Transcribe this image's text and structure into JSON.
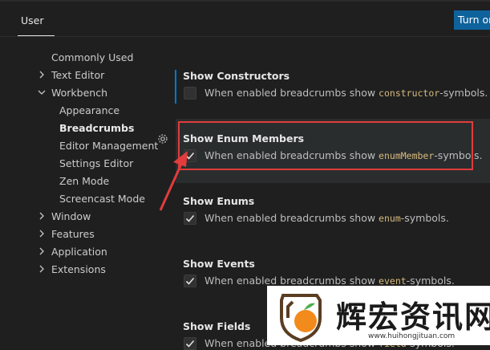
{
  "header": {
    "tab_user": "User",
    "turn_on_label": "Turn on"
  },
  "tree": {
    "commonly_used": "Commonly Used",
    "text_editor": "Text Editor",
    "workbench": "Workbench",
    "appearance": "Appearance",
    "breadcrumbs": "Breadcrumbs",
    "editor_management": "Editor Management",
    "settings_editor": "Settings Editor",
    "zen_mode": "Zen Mode",
    "screencast_mode": "Screencast Mode",
    "window": "Window",
    "features": "Features",
    "application": "Application",
    "extensions": "Extensions"
  },
  "settings": [
    {
      "title": "Show Constructors",
      "desc_pre": "When enabled breadcrumbs show ",
      "desc_code": "constructor",
      "desc_post": "-symbols.",
      "checked": false
    },
    {
      "title": "Show Enum Members",
      "desc_pre": "When enabled breadcrumbs show ",
      "desc_code": "enumMember",
      "desc_post": "-symbols.",
      "checked": true
    },
    {
      "title": "Show Enums",
      "desc_pre": "When enabled breadcrumbs show ",
      "desc_code": "enum",
      "desc_post": "-symbols.",
      "checked": true
    },
    {
      "title": "Show Events",
      "desc_pre": "When enabled breadcrumbs show ",
      "desc_code": "event",
      "desc_post": "-symbols.",
      "checked": true
    },
    {
      "title": "Show Fields",
      "desc_pre": "When enabled breadcrumbs show ",
      "desc_code": "field",
      "desc_post": "-symbols.",
      "checked": true
    }
  ],
  "watermark": {
    "brand": "辉宏资讯网",
    "url": "www.huihongjituan.com"
  },
  "colors": {
    "annotation": "#e23c3c",
    "accent": "#0078d4",
    "button": "#0e639c"
  },
  "icons": {
    "chevron_right": "chevron-right-icon",
    "chevron_down": "chevron-down-icon",
    "check": "check-icon",
    "gear": "gear-icon"
  }
}
